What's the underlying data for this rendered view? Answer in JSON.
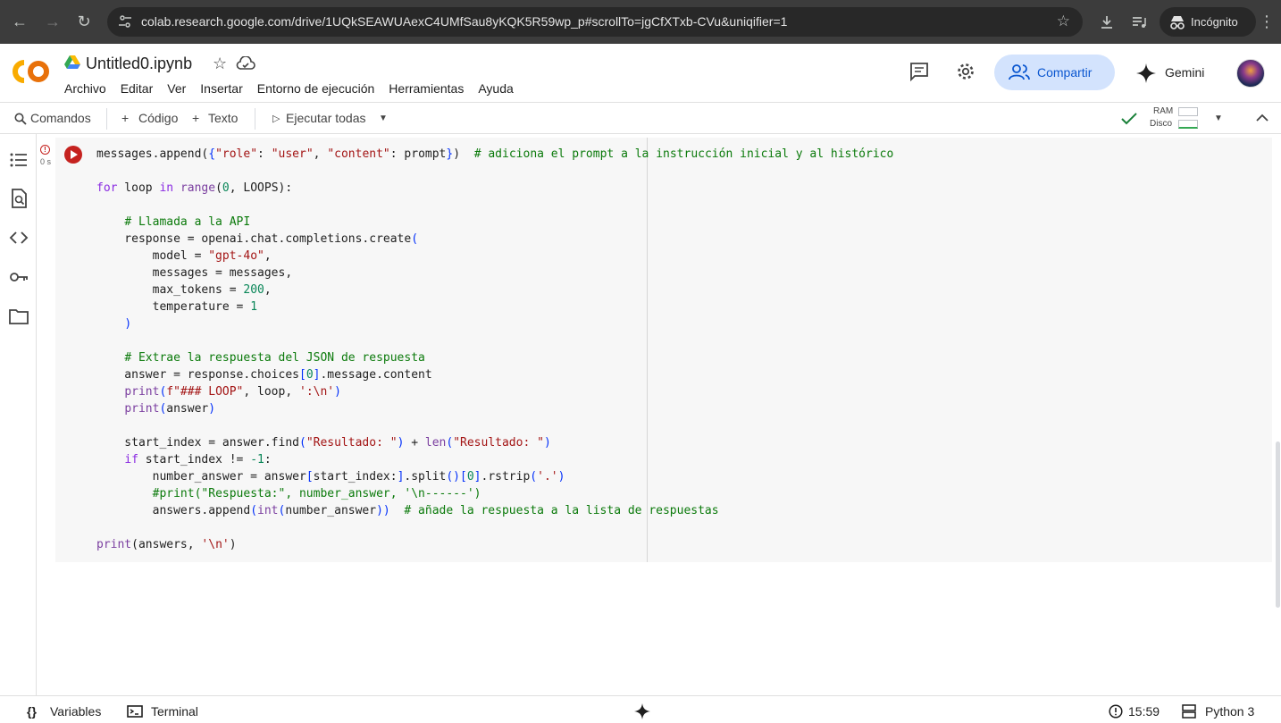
{
  "browser": {
    "url": "colab.research.google.com/drive/1UQkSEAWUAexC4UMfSau8yKQK5R59wp_p#scrollTo=jgCfXTxb-CVu&uniqifier=1",
    "incognito_label": "Incógnito"
  },
  "header": {
    "logo_text": "CO",
    "doc_title": "Untitled0.ipynb",
    "menu": [
      "Archivo",
      "Editar",
      "Ver",
      "Insertar",
      "Entorno de ejecución",
      "Herramientas",
      "Ayuda"
    ],
    "share_label": "Compartir",
    "gemini_label": "Gemini"
  },
  "toolbar": {
    "commands_label": "Comandos",
    "add_code_label": "Código",
    "add_text_label": "Texto",
    "run_all_label": "Ejecutar todas",
    "ram_label": "RAM",
    "disk_label": "Disco"
  },
  "cell": {
    "exec_time": "0 s"
  },
  "status": {
    "variables_label": "Variables",
    "terminal_label": "Terminal",
    "time": "15:59",
    "kernel": "Python 3"
  },
  "colors": {
    "chrome_bg": "#3c3c3c",
    "accent_blue": "#0b57d0",
    "share_bg": "#d3e3fd",
    "error_red": "#c5221f",
    "ok_green": "#34a853"
  }
}
